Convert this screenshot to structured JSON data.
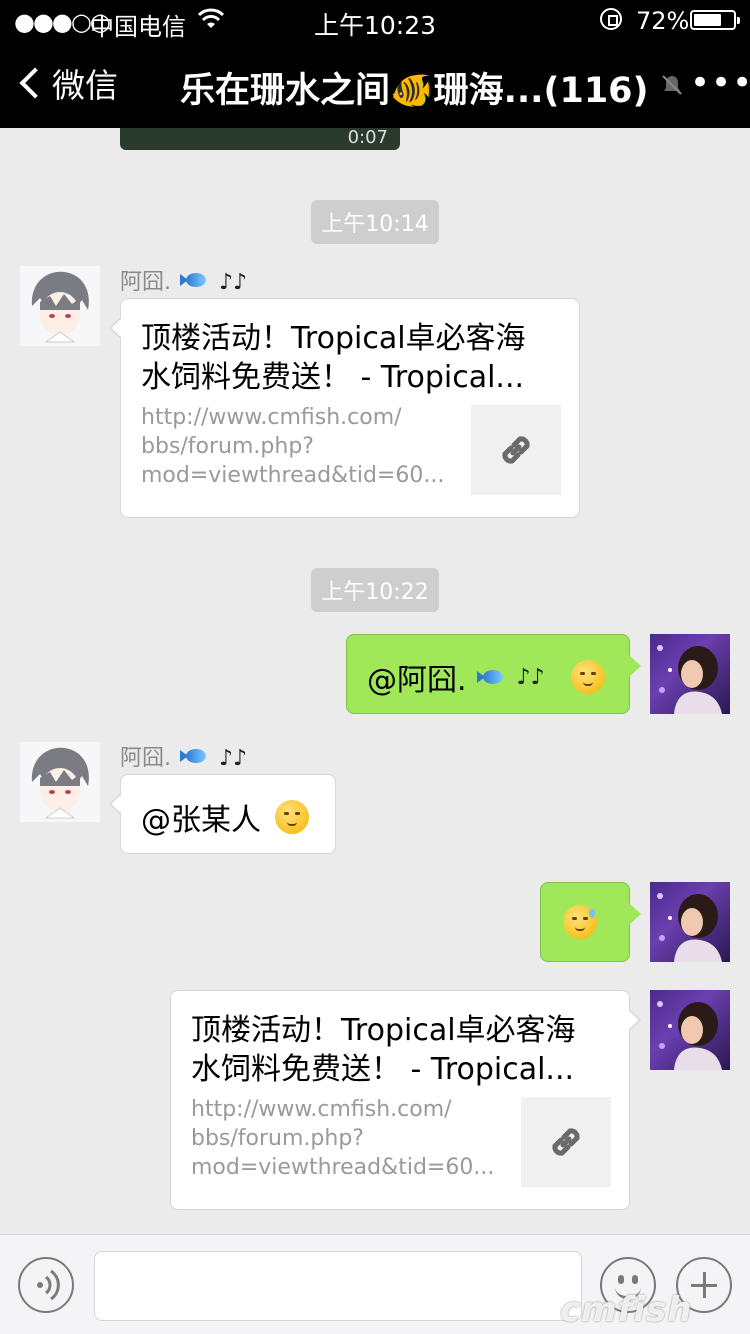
{
  "status_bar": {
    "signal": "●●●○○",
    "carrier": "中国电信",
    "time": "上午10:23",
    "battery_pct": "72%",
    "battery_level": 0.72
  },
  "nav": {
    "back_label": "微信",
    "title": "乐在珊水之间🐠珊海...(116)",
    "more": "•••"
  },
  "chat": {
    "video_duration": "0:07",
    "timestamps": [
      "上午10:14",
      "上午10:22"
    ],
    "messages": [
      {
        "sender": "阿囧.",
        "link_title_line1": "顶楼活动！Tropical卓必客海",
        "link_title_line2": "水饲料免费送！ - Tropical...",
        "link_desc_line1": "http://www.cmfish.com/",
        "link_desc_line2": "bbs/forum.php?",
        "link_desc_line3": "mod=viewthread&tid=60..."
      },
      {
        "text": "@阿囧."
      },
      {
        "sender": "阿囧.",
        "text": "@张某人"
      },
      {
        "emoji": "sweat-emoji"
      },
      {
        "link_title_line1": "顶楼活动！Tropical卓必客海",
        "link_title_line2": "水饲料免费送！ - Tropical...",
        "link_desc_line1": "http://www.cmfish.com/",
        "link_desc_line2": "bbs/forum.php?",
        "link_desc_line3": "mod=viewthread&tid=60..."
      }
    ]
  },
  "input": {
    "value": "",
    "placeholder": ""
  },
  "watermark": "cmfish",
  "colors": {
    "bar_bg": "#000000",
    "chat_bg": "#ebebeb",
    "green_bubble": "#a0e75a",
    "white_bubble": "#ffffff",
    "timestamp_bg": "#cecece"
  }
}
